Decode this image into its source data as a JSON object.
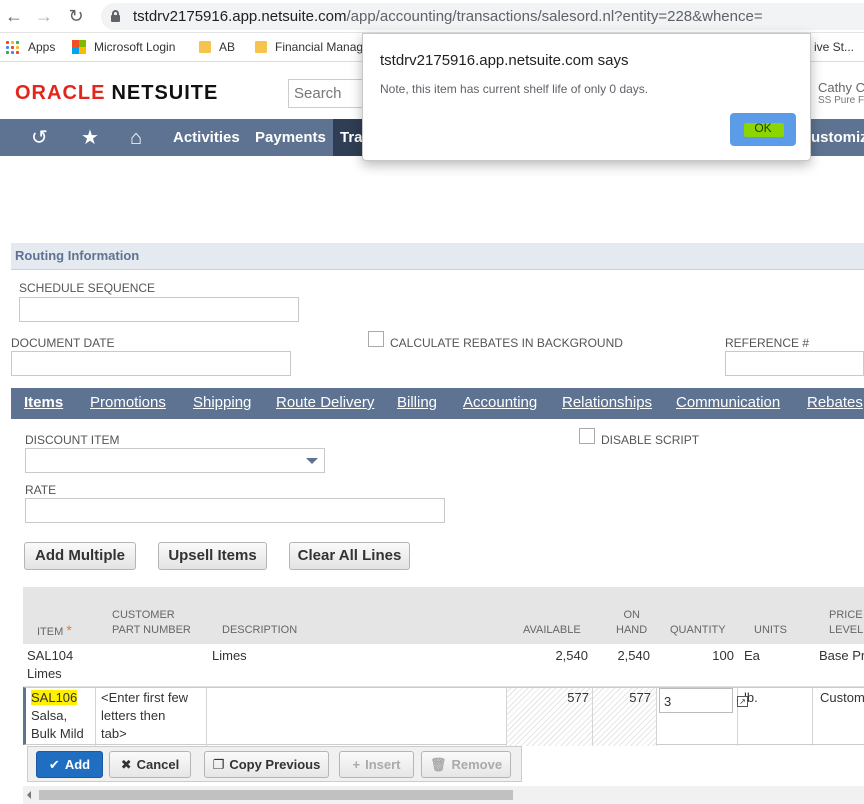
{
  "browser": {
    "url_host": "tstdrv2175916.app.netsuite.com",
    "url_path": "/app/accounting/transactions/salesord.nl?entity=228&whence=",
    "bookmarks": [
      "Apps",
      "Microsoft Login",
      "AB",
      "Financial Manage",
      "ive St..."
    ]
  },
  "header": {
    "logo_oracle": "ORACLE",
    "logo_netsuite": "NETSUITE",
    "search_placeholder": "Search",
    "user_name": "Cathy C",
    "user_role": "SS Pure F"
  },
  "nav": {
    "items": [
      "Activities",
      "Payments",
      "Tra",
      "ustomiz"
    ]
  },
  "dialog": {
    "title": "tstdrv2175916.app.netsuite.com says",
    "message": "Note, this item has current shelf life of only 0 days.",
    "ok_label": "OK"
  },
  "form": {
    "section_title": "Routing Information",
    "schedule_sequence_label": "SCHEDULE SEQUENCE",
    "document_date_label": "DOCUMENT DATE",
    "calc_rebates_label": "CALCULATE REBATES IN BACKGROUND",
    "reference_label": "REFERENCE #"
  },
  "tabs": [
    "Items",
    "Promotions",
    "Shipping",
    "Route Delivery",
    "Billing",
    "Accounting",
    "Relationships",
    "Communication",
    "Rebates"
  ],
  "items_tab": {
    "discount_item_label": "DISCOUNT ITEM",
    "disable_script_label": "DISABLE SCRIPT",
    "rate_label": "RATE",
    "buttons": [
      "Add Multiple",
      "Upsell Items",
      "Clear All Lines"
    ]
  },
  "table": {
    "headers": {
      "item": "ITEM",
      "required_mark": "*",
      "customer_part_1": "CUSTOMER",
      "customer_part_2": "PART NUMBER",
      "description": "DESCRIPTION",
      "available": "AVAILABLE",
      "on_hand_1": "ON",
      "on_hand_2": "HAND",
      "quantity": "QUANTITY",
      "units": "UNITS",
      "price_1": "PRICE",
      "price_2": "LEVEL"
    },
    "row1": {
      "item_code": "SAL104",
      "item_name": "Limes",
      "description": "Limes",
      "available": "2,540",
      "on_hand": "2,540",
      "quantity": "100",
      "units": "Ea",
      "price_level": "Base Pr"
    },
    "row2": {
      "item_code": "SAL106",
      "item_name_1": "Salsa,",
      "item_name_2": "Bulk Mild",
      "part_hint_1": "<Enter first few",
      "part_hint_2": "letters then",
      "part_hint_3": "tab>",
      "available": "577",
      "on_hand": "577",
      "quantity": "3",
      "units": "lb.",
      "price_level": "Custom"
    }
  },
  "actions": {
    "add": "Add",
    "cancel": "Cancel",
    "copy_previous": "Copy Previous",
    "insert": "Insert",
    "remove": "Remove"
  },
  "colors": {
    "nav_bar": "#5d7391",
    "logo_red": "#e3261b",
    "highlight": "#ffef00",
    "ok_highlight": "#8bd600",
    "primary_button": "#1f6ec2"
  }
}
